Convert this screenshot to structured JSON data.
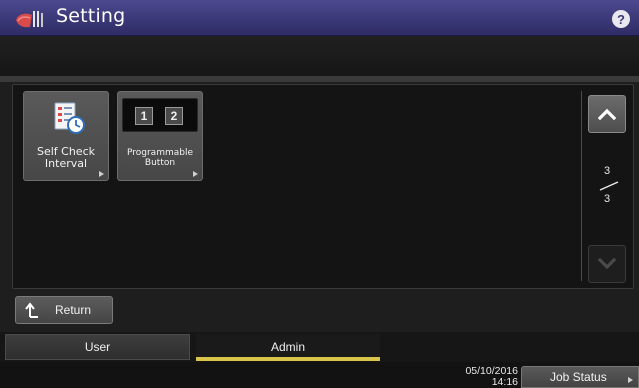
{
  "title_bar": {
    "title": "Setting",
    "help_label": "?"
  },
  "tiles": [
    {
      "label_line1": "Self Check",
      "label_line2": "Interval"
    },
    {
      "label_line1": "Programmable",
      "label_line2": "Button",
      "keys": [
        "1",
        "2"
      ]
    }
  ],
  "pager": {
    "current": "3",
    "total": "3"
  },
  "return_button": {
    "label": "Return"
  },
  "tabs": [
    {
      "label": "User",
      "active": false
    },
    {
      "label": "Admin",
      "active": true
    }
  ],
  "status": {
    "date": "05/10/2016",
    "time": "14:16",
    "job_status_label": "Job Status"
  },
  "colors": {
    "title_bar": "#3b3878",
    "active_tab_underline": "#d9c54a",
    "background": "#1e1e1e"
  }
}
